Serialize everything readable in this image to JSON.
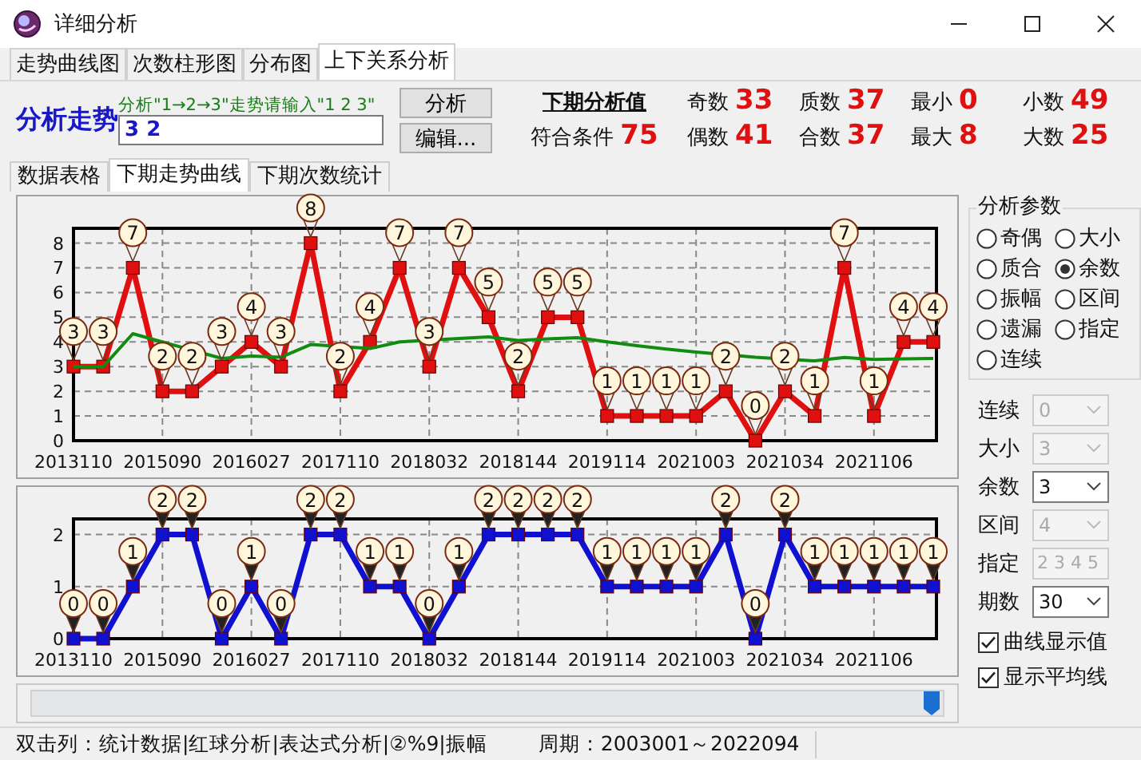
{
  "window": {
    "title": "详细分析"
  },
  "tabs": [
    {
      "label": "走势曲线图",
      "selected": false
    },
    {
      "label": "次数柱形图",
      "selected": false
    },
    {
      "label": "分布图",
      "selected": false
    },
    {
      "label": "上下关系分析",
      "selected": true
    }
  ],
  "analysis": {
    "label": "分析走势",
    "hint": "分析\"1→2→3\"走势请输入\"1 2 3\"",
    "value": "3 2",
    "buttons": [
      "分析",
      "编辑..."
    ]
  },
  "next_values": {
    "heading": "下期分析值",
    "match_label": "符合条件",
    "match_value": "75",
    "stats": [
      {
        "label": "奇数",
        "value": "33"
      },
      {
        "label": "偶数",
        "value": "41"
      },
      {
        "label": "质数",
        "value": "37"
      },
      {
        "label": "合数",
        "value": "37"
      },
      {
        "label": "最小",
        "value": "0"
      },
      {
        "label": "最大",
        "value": "8"
      },
      {
        "label": "小数",
        "value": "49"
      },
      {
        "label": "大数",
        "value": "25"
      }
    ]
  },
  "sub_tabs": [
    {
      "label": "数据表格",
      "selected": false
    },
    {
      "label": "下期走势曲线",
      "selected": true
    },
    {
      "label": "下期次数统计",
      "selected": false
    }
  ],
  "charts": [
    {
      "chart_data": {
        "type": "line",
        "ylim": [
          0,
          8.6
        ],
        "yticks": [
          0,
          1,
          2,
          3,
          4,
          5,
          6,
          7,
          8
        ],
        "grid": true,
        "categories": [
          "2013110",
          null,
          null,
          "2015090",
          null,
          null,
          "2016027",
          null,
          null,
          "2017110",
          null,
          null,
          "2018032",
          null,
          null,
          "2018144",
          null,
          null,
          "2019114",
          null,
          null,
          "2021003",
          null,
          null,
          "2021034",
          null,
          null,
          "2021106",
          null,
          null
        ],
        "series": [
          {
            "color": "#e01010",
            "marker": "square",
            "values": [
              3,
              3,
              7,
              2,
              2,
              3,
              4,
              3,
              8,
              2,
              4,
              7,
              3,
              7,
              5,
              2,
              5,
              5,
              1,
              1,
              1,
              1,
              2,
              0,
              2,
              1,
              7,
              1,
              4,
              4
            ],
            "value_labels": [
              "3",
              "3",
              "7",
              "2",
              "2",
              "3",
              "4",
              "3",
              "8",
              "2",
              "4",
              "7",
              "3",
              "7",
              "5",
              "2",
              "5",
              "5",
              "1",
              "1",
              "1",
              "1",
              "2",
              "0",
              "2",
              "1",
              "7",
              "1",
              "4",
              "4"
            ]
          },
          {
            "color": "#108c10",
            "values": [
              3,
              3,
              4.33,
              null,
              null,
              3.33,
              3.43,
              3.38,
              3.89,
              null,
              3.73,
              4,
              null,
              4.14,
              4.2,
              4.06,
              4.12,
              4.17,
              4,
              3.85,
              3.71,
              3.59,
              null,
              3.38,
              null,
              3.23,
              3.37,
              3.29,
              3.31,
              3.33
            ]
          }
        ]
      }
    },
    {
      "chart_data": {
        "type": "line",
        "ylim": [
          0,
          2.3
        ],
        "yticks": [
          0,
          1,
          2
        ],
        "grid": true,
        "categories": [
          "2013110",
          null,
          null,
          "2015090",
          null,
          null,
          "2016027",
          null,
          null,
          "2017110",
          null,
          null,
          "2018032",
          null,
          null,
          "2018144",
          null,
          null,
          "2019114",
          null,
          null,
          "2021003",
          null,
          null,
          "2021034",
          null,
          null,
          "2021106",
          null,
          null
        ],
        "series": [
          {
            "color": "#1010d0",
            "marker": "square",
            "values": [
              0,
              0,
              1,
              2,
              2,
              0,
              1,
              0,
              2,
              2,
              1,
              1,
              0,
              1,
              2,
              2,
              2,
              2,
              1,
              1,
              1,
              1,
              2,
              0,
              2,
              1,
              1,
              1,
              1,
              1
            ],
            "value_labels": [
              "0",
              "0",
              "1",
              "2",
              "2",
              "0",
              "1",
              "0",
              "2",
              "2",
              "1",
              "1",
              "0",
              "1",
              "2",
              "2",
              "2",
              "2",
              "1",
              "1",
              "1",
              "1",
              "2",
              "0",
              "2",
              "1",
              "1",
              "1",
              "1",
              "1"
            ]
          }
        ]
      }
    }
  ],
  "params": {
    "title": "分析参数",
    "options": [
      {
        "label": "奇偶",
        "selected": false
      },
      {
        "label": "大小",
        "selected": false
      },
      {
        "label": "质合",
        "selected": false
      },
      {
        "label": "余数",
        "selected": true
      },
      {
        "label": "振幅",
        "selected": false
      },
      {
        "label": "区间",
        "selected": false
      },
      {
        "label": "遗漏",
        "selected": false
      },
      {
        "label": "指定",
        "selected": false
      },
      {
        "label": "连续",
        "selected": false
      }
    ],
    "fields": [
      {
        "label": "连续",
        "value": "0",
        "kind": "select",
        "disabled": true
      },
      {
        "label": "大小",
        "value": "3",
        "kind": "select",
        "disabled": true
      },
      {
        "label": "余数",
        "value": "3",
        "kind": "select",
        "disabled": false
      },
      {
        "label": "区间",
        "value": "4",
        "kind": "select",
        "disabled": true
      },
      {
        "label": "指定",
        "value": "2 3 4 5",
        "kind": "text",
        "disabled": true
      },
      {
        "label": "期数",
        "value": "30",
        "kind": "select",
        "disabled": false
      }
    ],
    "checkboxes": [
      {
        "label": "曲线显示值",
        "checked": true
      },
      {
        "label": "显示平均线",
        "checked": true
      }
    ]
  },
  "status_bar": [
    "双击列：统计数据|红球分析|表达式分析|②%9|振幅",
    "周期：2003001～2022094"
  ]
}
